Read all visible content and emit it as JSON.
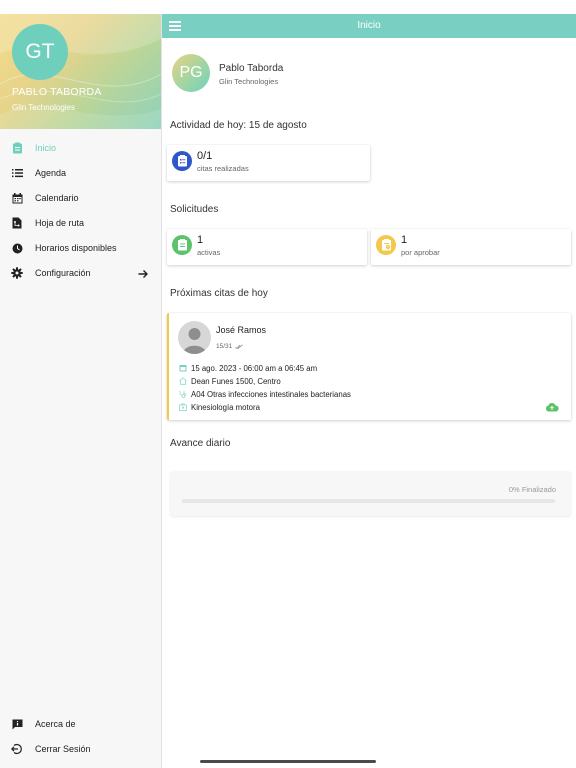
{
  "topbar": {
    "title": "Inicio"
  },
  "sidebar": {
    "avatar_initials": "GT",
    "user_name": "PABLO TABORDA",
    "company": "Glin Technologies",
    "items": [
      {
        "label": "Inicio",
        "icon": "clipboard-icon",
        "active": true
      },
      {
        "label": "Agenda",
        "icon": "list-icon"
      },
      {
        "label": "Calendario",
        "icon": "calendar-icon"
      },
      {
        "label": "Hoja de ruta",
        "icon": "route-sheet-icon"
      },
      {
        "label": "Horarios disponibles",
        "icon": "clock-icon"
      },
      {
        "label": "Configuración",
        "icon": "gear-icon",
        "trailing": "arrow-right-icon"
      }
    ],
    "bottom_items": [
      {
        "label": "Acerca de",
        "icon": "info-message-icon"
      },
      {
        "label": "Cerrar Sesión",
        "icon": "logout-icon"
      }
    ]
  },
  "profile": {
    "initials": "PG",
    "name": "Pablo Taborda",
    "company": "Glin Technologies"
  },
  "activity": {
    "title": "Actividad de hoy: 15 de agosto",
    "citas": {
      "value": "0/1",
      "label": "citas realizadas"
    }
  },
  "requests": {
    "title": "Solicitudes",
    "active": {
      "value": "1",
      "label": "activas"
    },
    "pending": {
      "value": "1",
      "label": "por aprobar"
    }
  },
  "upcoming": {
    "title": "Próximas citas de hoy",
    "appointment": {
      "patient": "José Ramos",
      "count": "15/31",
      "datetime": "15 ago. 2023 - 06:00 am a 06:45 am",
      "address": "Dean Funes 1500, Centro",
      "diagnosis": "A04 Otras infecciones intestinales bacterianas",
      "service": "Kinesiología motora"
    }
  },
  "progress": {
    "title": "Avance diario",
    "label": "0% Finalizado",
    "value": 0
  },
  "colors": {
    "accent": "#79cfc1",
    "blue": "#2f57c9",
    "green": "#5cc36b",
    "yellow": "#f2c94c"
  }
}
